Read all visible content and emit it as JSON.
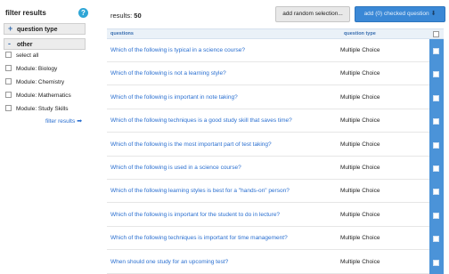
{
  "sidebar": {
    "title": "filter results",
    "help_icon": "?",
    "facets": [
      {
        "symbol": "+",
        "label": "question type"
      },
      {
        "symbol": "-",
        "label": "other"
      }
    ],
    "options": [
      "select all",
      "Module: Biology",
      "Module: Chemistry",
      "Module: Mathematics",
      "Module: Study Skills"
    ],
    "filter_link": "filter results",
    "filter_link_arrow": "➡"
  },
  "main": {
    "results_label": "results:",
    "results_count": "50",
    "random_button": "add random selection...",
    "add_button": "add (0) checked question",
    "add_button_icon": "download-icon",
    "columns": {
      "questions": "questions",
      "type": "question type"
    },
    "rows": [
      {
        "question": "Which of the following is typical in a science course?",
        "type": "Multiple Choice"
      },
      {
        "question": "Which of the following is not a learning style?",
        "type": "Multiple Choice"
      },
      {
        "question": "Which of the following is important in note taking?",
        "type": "Multiple Choice"
      },
      {
        "question": "Which of the following techniques is a good study skill that saves time?",
        "type": "Multiple Choice"
      },
      {
        "question": "Which of the following is the most important part of test taking?",
        "type": "Multiple Choice"
      },
      {
        "question": "Which of the following is used in a science course?",
        "type": "Multiple Choice"
      },
      {
        "question": "Which of the following learning styles is best for a \"hands-on\" person?",
        "type": "Multiple Choice"
      },
      {
        "question": "Which of the following is important for the student to do in lecture?",
        "type": "Multiple Choice"
      },
      {
        "question": "Which of the following techniques is important for time management?",
        "type": "Multiple Choice"
      },
      {
        "question": "When should one study for an upcoming test?",
        "type": "Multiple Choice"
      }
    ]
  },
  "colors": {
    "link": "#2a6fd0",
    "accent": "#3a88d6",
    "checkbox_column": "#4b93d8"
  }
}
